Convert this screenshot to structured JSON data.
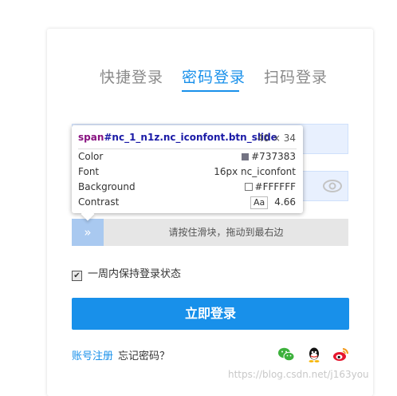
{
  "tabs": {
    "quick": "快捷登录",
    "password": "密码登录",
    "scan": "扫码登录"
  },
  "slider": {
    "arrow": "»",
    "text": "请按住滑块，拖动到最右边"
  },
  "tooltip": {
    "tag": "span",
    "selector": "#nc_1_n1z.nc_iconfont.btn_slide",
    "size": "40 × 34",
    "rows": {
      "color_label": "Color",
      "color_value": "#737383",
      "font_label": "Font",
      "font_value": "16px nc_iconfont",
      "background_label": "Background",
      "background_value": "#FFFFFF",
      "contrast_label": "Contrast",
      "contrast_badge": "Aa",
      "contrast_value": "4.66"
    }
  },
  "remember": {
    "label": "一周内保持登录状态",
    "checked": true
  },
  "login_button": "立即登录",
  "footer": {
    "register": "账号注册",
    "forgot": "忘记密码？"
  },
  "social_icons": [
    "wechat-icon",
    "qq-icon",
    "weibo-icon"
  ],
  "watermark": "https://blog.csdn.net/j163you",
  "colors": {
    "accent": "#1890ea",
    "input_bg": "#e8f0fe",
    "slider_btn": "#a9c9f0"
  }
}
